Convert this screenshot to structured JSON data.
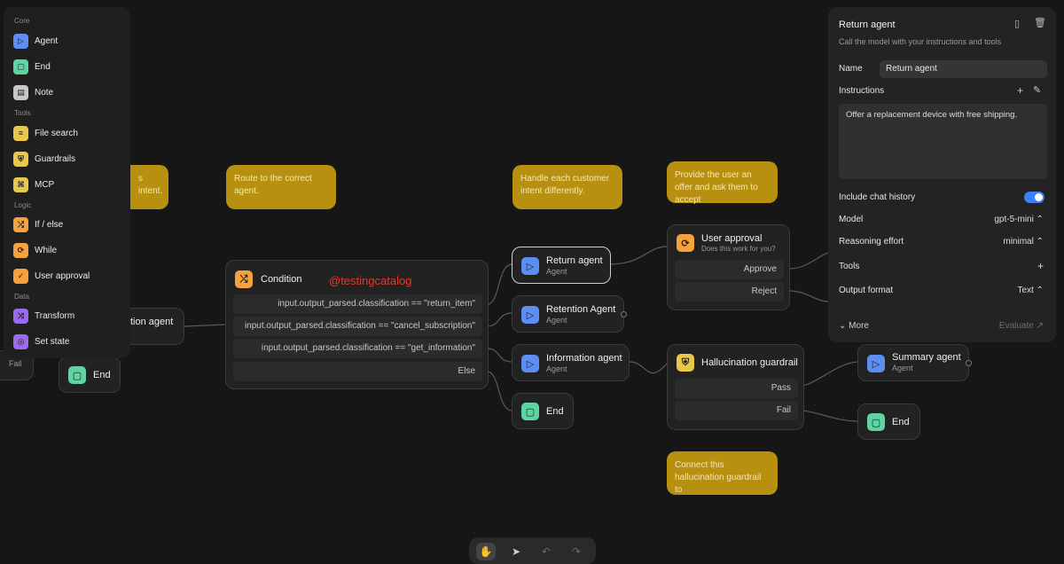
{
  "sidebar": {
    "sections": [
      "Core",
      "Tools",
      "Logic",
      "Data"
    ],
    "items": [
      {
        "label": "Agent",
        "icon": "agent-icon",
        "color": "#5d8ef3"
      },
      {
        "label": "End",
        "icon": "end-icon",
        "color": "#5fd4a3"
      },
      {
        "label": "Note",
        "icon": "note-icon",
        "color": "#c8c8c8"
      },
      {
        "label": "File search",
        "icon": "file-search-icon",
        "color": "#e7c84a"
      },
      {
        "label": "Guardrails",
        "icon": "guardrails-icon",
        "color": "#e7c84a"
      },
      {
        "label": "MCP",
        "icon": "mcp-icon",
        "color": "#e7c84a"
      },
      {
        "label": "If / else",
        "icon": "if-else-icon",
        "color": "#f5a23c"
      },
      {
        "label": "While",
        "icon": "while-icon",
        "color": "#f5a23c"
      },
      {
        "label": "User approval",
        "icon": "user-approval-icon",
        "color": "#f5a23c"
      },
      {
        "label": "Transform",
        "icon": "transform-icon",
        "color": "#9a6af0"
      },
      {
        "label": "Set state",
        "icon": "set-state-icon",
        "color": "#9a6af0"
      }
    ]
  },
  "notes": {
    "intent": "s intent.",
    "route": "Route to the correct agent.",
    "handle": "Handle each customer intent differently.",
    "approval": "Provide the user an offer and ask them to accept",
    "connect": "Connect this hallucination guardrail to"
  },
  "nodes": {
    "partial_agent": "tion agent",
    "partial_fail": "Fail",
    "end_left": "End",
    "condition": {
      "title": "Condition",
      "rows": [
        "input.output_parsed.classification == \"return_item\"",
        "input.output_parsed.classification == \"cancel_subscription\"",
        "input.output_parsed.classification == \"get_information\"",
        "Else"
      ]
    },
    "watermark": "@testingcatalog",
    "return_agent": {
      "title": "Return agent",
      "sub": "Agent"
    },
    "retention_agent": {
      "title": "Retention Agent",
      "sub": "Agent"
    },
    "information_agent": {
      "title": "Information agent",
      "sub": "Agent"
    },
    "end_mid": "End",
    "user_approval": {
      "title": "User approval",
      "sub": "Does this work for you?",
      "rows": [
        "Approve",
        "Reject"
      ]
    },
    "hallucination": {
      "title": "Hallucination guardrail",
      "rows": [
        "Pass",
        "Fail"
      ]
    },
    "summary_agent": {
      "title": "Summary agent",
      "sub": "Agent"
    },
    "end_right": "End"
  },
  "panel": {
    "title": "Return agent",
    "subtitle": "Call the model with your instructions and tools",
    "name_label": "Name",
    "name_value": "Return agent",
    "instructions_label": "Instructions",
    "instructions_value": "Offer a replacement device with free shipping.",
    "chat_history_label": "Include chat history",
    "chat_history_on": true,
    "model_label": "Model",
    "model_value": "gpt-5-mini",
    "reasoning_label": "Reasoning effort",
    "reasoning_value": "minimal",
    "tools_label": "Tools",
    "output_label": "Output format",
    "output_value": "Text",
    "more_label": "More",
    "evaluate_label": "Evaluate"
  },
  "toolbar": {
    "tools": [
      "hand-icon",
      "pointer-icon",
      "undo-icon",
      "redo-icon"
    ]
  }
}
